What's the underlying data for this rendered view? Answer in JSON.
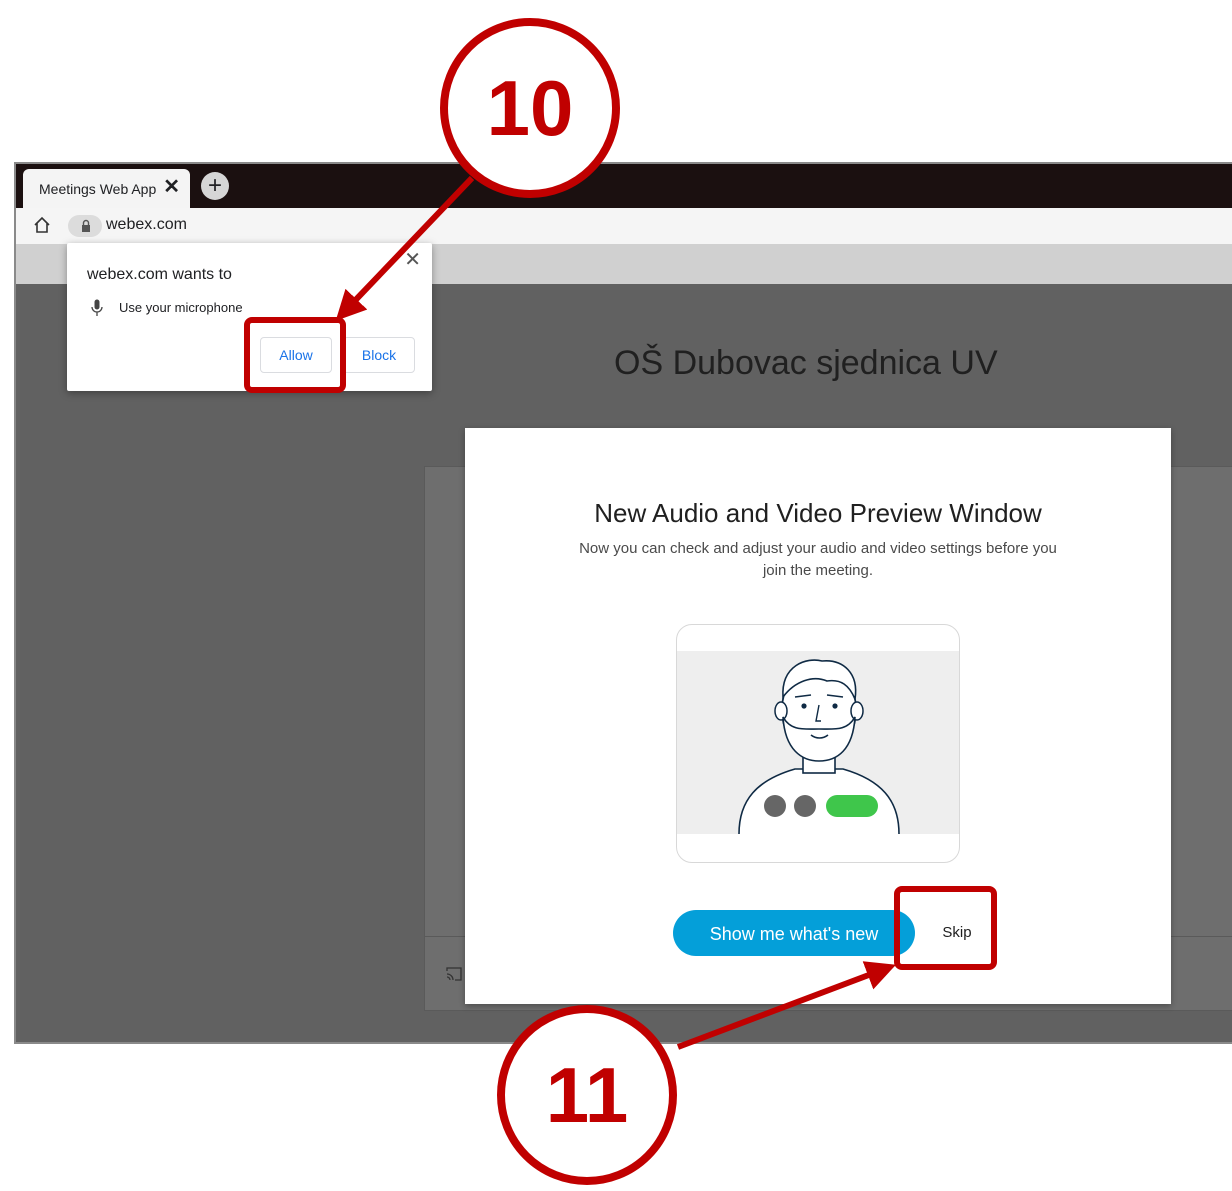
{
  "browser": {
    "tab_title": "Meetings Web App",
    "tab_close": "✕",
    "new_tab": "+",
    "url": "webex.com"
  },
  "permission_popup": {
    "heading": "webex.com wants to",
    "permission": "Use your microphone",
    "allow_label": "Allow",
    "block_label": "Block",
    "close": "✕"
  },
  "meeting": {
    "title": "OŠ Dubovac sjednica UV"
  },
  "modal": {
    "title": "New Audio and Video Preview Window",
    "description": "Now you can check and adjust your audio and video settings before you join the meeting.",
    "show_button": "Show me what's new",
    "skip_button": "Skip"
  },
  "annotations": {
    "step_10": "10",
    "step_11": "11",
    "color": "#c00000"
  },
  "colors": {
    "accent": "#049fd9",
    "green_toggle": "#3fc64b",
    "link_blue": "#1a73e8"
  }
}
